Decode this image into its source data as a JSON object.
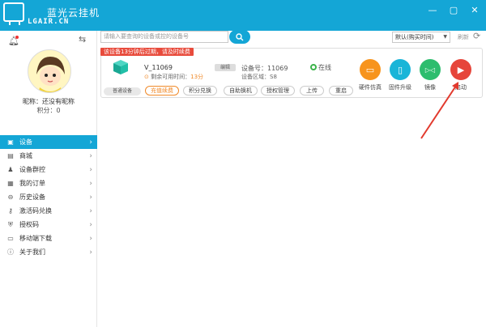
{
  "titlebar": {
    "title": "蓝光云挂机",
    "subtitle": "LGAIR.CN",
    "min_label": "—",
    "max_label": "▢",
    "close_label": "✕"
  },
  "sidebar": {
    "nickname": "昵称：还没有昵称",
    "points": "积分：0",
    "items": [
      {
        "label": "设备",
        "icon": "device-icon",
        "glyph": "▣"
      },
      {
        "label": "商城",
        "icon": "store-icon",
        "glyph": "▤"
      },
      {
        "label": "设备群控",
        "icon": "group-icon",
        "glyph": "♟"
      },
      {
        "label": "我的订单",
        "icon": "order-icon",
        "glyph": "▦"
      },
      {
        "label": "历史设备",
        "icon": "history-icon",
        "glyph": "⊖"
      },
      {
        "label": "激活码兑换",
        "icon": "key-icon",
        "glyph": "⚷"
      },
      {
        "label": "授权码",
        "icon": "shield-icon",
        "glyph": "⛨"
      },
      {
        "label": "移动端下载",
        "icon": "download-icon",
        "glyph": "▭"
      },
      {
        "label": "关于我们",
        "icon": "info-icon",
        "glyph": "ⓘ"
      }
    ]
  },
  "search": {
    "placeholder": "请输入要查询的设备或控的设备号"
  },
  "sort": {
    "value": "默认(购买时间)",
    "refresh_label": "刷新"
  },
  "device": {
    "expire_notice": "该设备13分钟后过期，请及时续费",
    "name": "V_11069",
    "remaining_label": "剩余可用时间：",
    "remaining_value": "13分",
    "edit_label": "编辑",
    "device_no": "设备号：11069",
    "region": "设备区域：S8",
    "status": "在线",
    "type": "普通设备",
    "actions": [
      "充值续费",
      "积分兑换",
      "自助换机",
      "授权管理",
      "上传",
      "重启"
    ],
    "quick": [
      {
        "label": "硬件仿真",
        "color": "#f7941d",
        "glyph": "▭"
      },
      {
        "label": "固件升级",
        "color": "#1ab5d8",
        "glyph": "▯"
      },
      {
        "label": "镜像",
        "color": "#2dbd6e",
        "glyph": "▷◁"
      },
      {
        "label": "启动",
        "color": "#e6453a",
        "glyph": "▶"
      }
    ]
  },
  "colors": {
    "accent": "#14a6d6",
    "warning": "#e84b3c",
    "online": "#3bb34a"
  }
}
